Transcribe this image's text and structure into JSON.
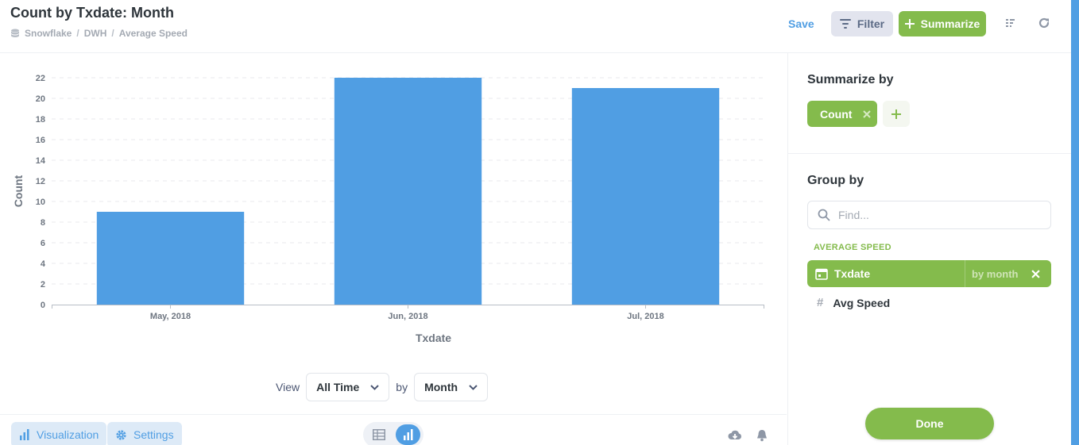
{
  "header": {
    "title": "Count by Txdate: Month",
    "breadcrumb": [
      "Snowflake",
      "DWH",
      "Average Speed"
    ],
    "save_label": "Save",
    "filter_label": "Filter",
    "summarize_label": "Summarize"
  },
  "chart_data": {
    "type": "bar",
    "categories": [
      "May, 2018",
      "Jun, 2018",
      "Jul, 2018"
    ],
    "values": [
      9,
      22,
      21
    ],
    "xlabel": "Txdate",
    "ylabel": "Count",
    "ylim": [
      0,
      22
    ],
    "yticks": [
      0,
      2,
      4,
      6,
      8,
      10,
      12,
      14,
      16,
      18,
      20,
      22
    ],
    "grid": true,
    "color": "#509ee3"
  },
  "controls": {
    "view_label": "View",
    "time_value": "All Time",
    "by_label": "by",
    "granularity_value": "Month"
  },
  "footer": {
    "visualization_label": "Visualization",
    "settings_label": "Settings"
  },
  "sidebar": {
    "summarize_heading": "Summarize by",
    "metric_label": "Count",
    "group_heading": "Group by",
    "search_placeholder": "Find...",
    "section_label": "AVERAGE SPEED",
    "active_dimension": "Txdate",
    "active_bucket": "by month",
    "other_dimension": "Avg Speed",
    "done_label": "Done"
  },
  "colors": {
    "accent": "#509ee3",
    "summarize_green": "#84bb4c"
  }
}
